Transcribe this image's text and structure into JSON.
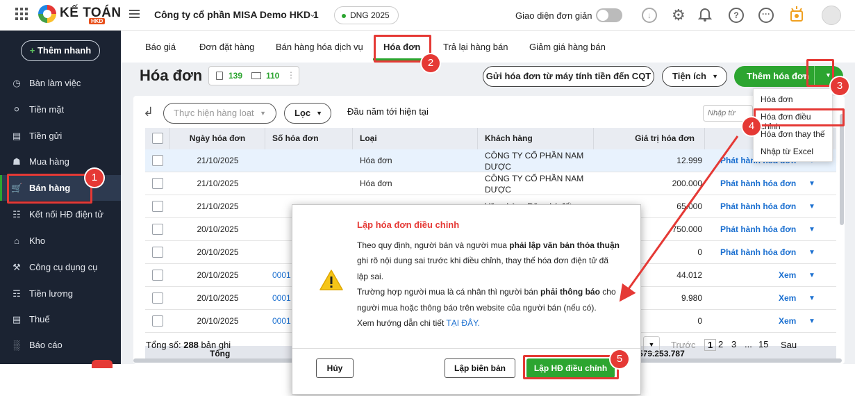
{
  "topbar": {
    "brand": "KẾ TOÁN",
    "brand_tag": "HKD",
    "company": "Công ty cổ phần MISA Demo HKD 1",
    "branch": "DNG 2025",
    "simple_mode": "Giao diện đơn giản"
  },
  "sidebar": {
    "quick_add": "Thêm nhanh",
    "items": [
      {
        "label": "Bàn làm việc",
        "icon": "desk-icon"
      },
      {
        "label": "Tiền mặt",
        "icon": "money-bag-icon"
      },
      {
        "label": "Tiền gửi",
        "icon": "bank-icon"
      },
      {
        "label": "Mua hàng",
        "icon": "shopping-bag-icon"
      },
      {
        "label": "Bán hàng",
        "icon": "cart-icon"
      },
      {
        "label": "Kết nối HĐ điện tử",
        "icon": "e-invoice-icon"
      },
      {
        "label": "Kho",
        "icon": "warehouse-icon"
      },
      {
        "label": "Công cụ dụng cụ",
        "icon": "tools-icon"
      },
      {
        "label": "Tiền lương",
        "icon": "payroll-icon"
      },
      {
        "label": "Thuế",
        "icon": "tax-icon"
      },
      {
        "label": "Báo cáo",
        "icon": "report-icon"
      }
    ]
  },
  "tabs": [
    "Báo giá",
    "Đơn đặt hàng",
    "Bán hàng hóa dịch vụ",
    "Hóa đơn",
    "Trả lại hàng bán",
    "Giảm giá hàng bán"
  ],
  "page": {
    "title": "Hóa đơn",
    "count_a": "139",
    "count_b": "110",
    "send_btn": "Gửi hóa đơn từ máy tính tiền đến CQT",
    "utility_btn": "Tiện ích",
    "add_btn": "Thêm hóa đơn"
  },
  "toolbar": {
    "batch": "Thực hiện hàng loạt",
    "filter": "Lọc",
    "period": "Đầu năm tới hiện tại",
    "search_placeholder": "Nhập từ"
  },
  "table": {
    "headers": [
      "Ngày hóa đơn",
      "Số hóa đơn",
      "Loại",
      "Khách hàng",
      "Giá trị hóa đơn"
    ],
    "rows": [
      {
        "date": "21/10/2025",
        "no": "",
        "type": "Hóa đơn",
        "customer": "CÔNG TY CỔ PHẦN NAM DƯỢC",
        "value": "12.999",
        "action": "Phát hành hóa đơn"
      },
      {
        "date": "21/10/2025",
        "no": "",
        "type": "Hóa đơn",
        "customer": "CÔNG TY CỔ PHẦN NAM DƯỢC",
        "value": "200.000",
        "action": "Phát hành hóa đơn"
      },
      {
        "date": "21/10/2025",
        "no": "",
        "type": "",
        "customer": "Văn phòng Đăng ký đất",
        "value": "65.000",
        "action": "Phát hành hóa đơn"
      },
      {
        "date": "20/10/2025",
        "no": "",
        "type": "",
        "customer": "",
        "value": "750.000",
        "action": "Phát hành hóa đơn"
      },
      {
        "date": "20/10/2025",
        "no": "",
        "type": "",
        "customer": "",
        "value": "0",
        "action": "Phát hành hóa đơn"
      },
      {
        "date": "20/10/2025",
        "no": "0001",
        "type": "",
        "customer": "",
        "value": "44.012",
        "action": "Xem"
      },
      {
        "date": "20/10/2025",
        "no": "0001",
        "type": "",
        "customer": "",
        "value": "9.980",
        "action": "Xem"
      },
      {
        "date": "20/10/2025",
        "no": "0001",
        "type": "",
        "customer": "",
        "value": "0",
        "action": "Xem"
      }
    ],
    "total_label": "Tổng",
    "total_value": "2.579.253.787"
  },
  "footer": {
    "total_prefix": "Tổng số:",
    "total_count": "288",
    "total_suffix": "bản ghi",
    "prev": "Trước",
    "pages": [
      "1",
      "2",
      "3",
      "...",
      "15"
    ],
    "next": "Sau"
  },
  "dropdown": {
    "items": [
      "Hóa đơn",
      "Hóa đơn điều chỉnh",
      "Hóa đơn thay thế",
      "Nhập từ Excel"
    ]
  },
  "dialog": {
    "title": "Lập hóa đơn điều chỉnh",
    "p1_a": "Theo quy định, người bán và người mua ",
    "p1_b": "phải lập văn bản thỏa thuận",
    "p1_c": " ghi rõ nội dung sai trước khi điều chỉnh, thay thế hóa đơn điện tử đã lập sai.",
    "p2_a": "Trường hợp người mua là cá nhân thì người bán ",
    "p2_b": "phải thông báo",
    "p2_c": " cho người mua hoặc thông báo trên website của người bán (nếu có).",
    "p3_a": "Xem hướng dẫn chi tiết ",
    "p3_link": "TẠI ĐÂY.",
    "cancel": "Hủy",
    "record": "Lập biên bản",
    "confirm": "Lập HĐ điều chỉnh"
  },
  "annotations": [
    "1",
    "2",
    "3",
    "4",
    "5"
  ],
  "colors": {
    "accent": "#2ca530",
    "sidebar": "#1b2332",
    "annotation": "#e53935",
    "link": "#1a6fd0"
  }
}
